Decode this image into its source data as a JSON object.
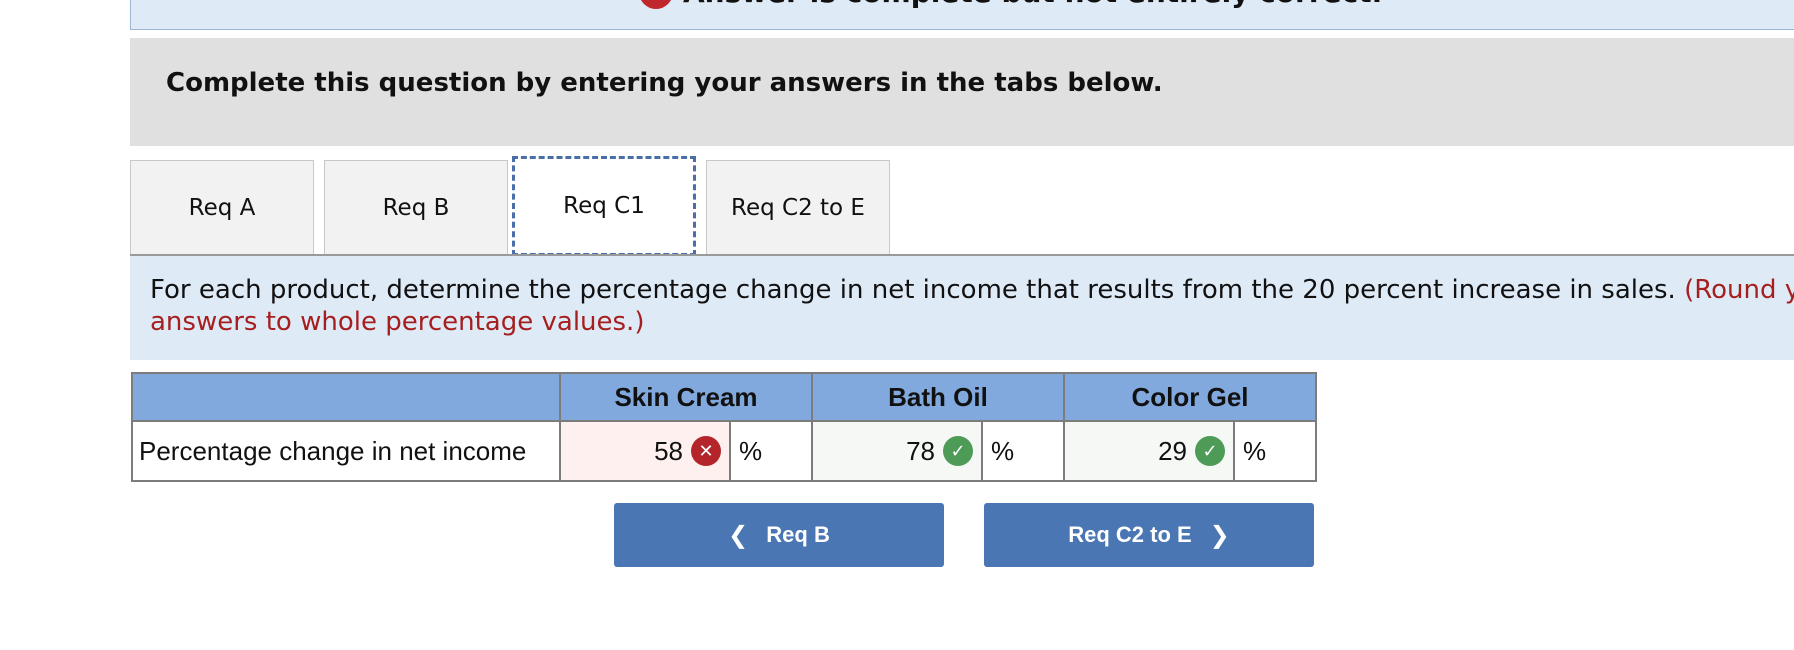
{
  "banner": {
    "status_icon": "x-circle-icon",
    "text": "Answer is complete but not entirely correct."
  },
  "instruction": "Complete this question by entering your answers in the tabs below.",
  "tabs": [
    {
      "label": "Req A",
      "active": false
    },
    {
      "label": "Req B",
      "active": false
    },
    {
      "label": "Req C1",
      "active": true
    },
    {
      "label": "Req C2 to E",
      "active": false
    }
  ],
  "prompt": {
    "text": "For each product, determine the percentage change in net income that results from the 20 percent  increase in sales.",
    "hint": "(Round your answers to whole percentage values.)"
  },
  "table": {
    "headers": [
      "",
      "Skin Cream",
      "Bath Oil",
      "Color Gel"
    ],
    "row_label": "Percentage change in net income",
    "cells": [
      {
        "value": "58",
        "status": "incorrect",
        "unit": "%"
      },
      {
        "value": "78",
        "status": "correct",
        "unit": "%"
      },
      {
        "value": "29",
        "status": "correct",
        "unit": "%"
      }
    ]
  },
  "nav": {
    "prev_label": "Req B",
    "next_label": "Req C2 to E"
  },
  "colors": {
    "accent_button": "#4a76b4",
    "header_blue": "#82a9dd",
    "incorrect_red": "#b3252a",
    "correct_green": "#4d9b57"
  }
}
